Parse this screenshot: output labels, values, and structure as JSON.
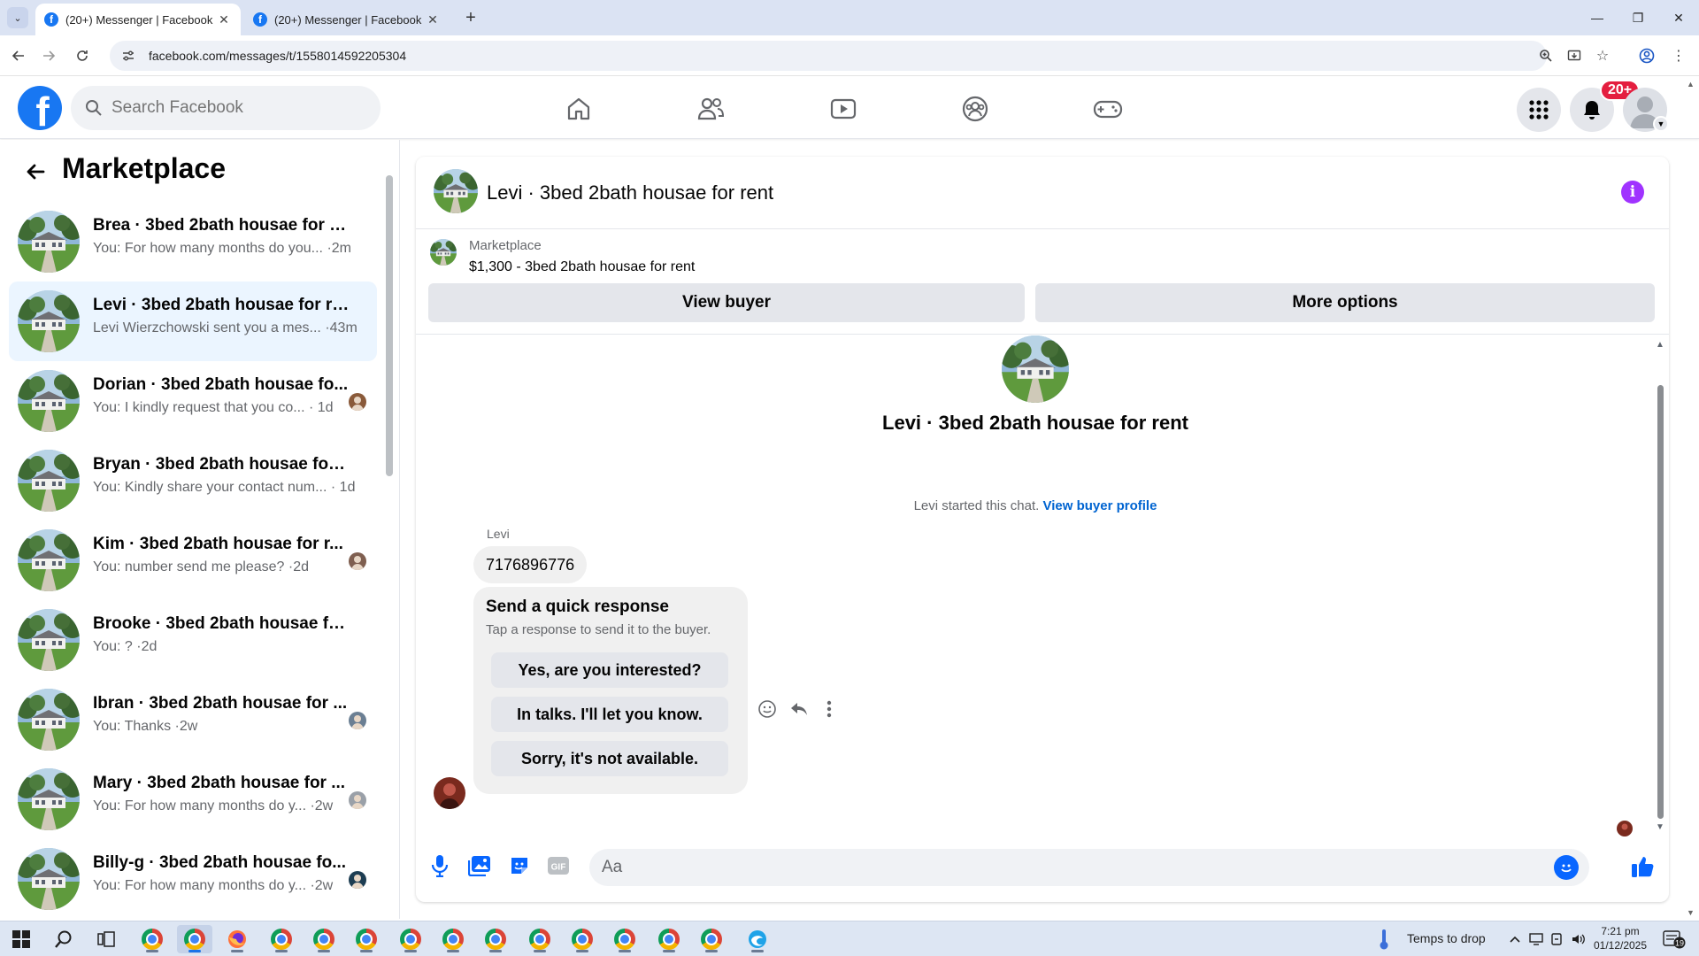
{
  "browser": {
    "tabs": [
      {
        "title": "(20+) Messenger | Facebook",
        "active": true
      },
      {
        "title": "(20+) Messenger | Facebook",
        "active": false
      }
    ],
    "url": "facebook.com/messages/t/1558014592205304"
  },
  "header": {
    "search_placeholder": "Search Facebook",
    "notification_count": "20+",
    "nav_icons": [
      "home-icon",
      "friends-icon",
      "watch-icon",
      "groups-icon",
      "gaming-icon"
    ]
  },
  "sidebar": {
    "title": "Marketplace",
    "conversations": [
      {
        "name": "Brea · 3bed 2bath housae for rent",
        "preview": "You: For how many months do you... ·2m",
        "active": false,
        "mini_avatar": false
      },
      {
        "name": "Levi · 3bed 2bath housae for rent",
        "preview": "Levi Wierzchowski sent you a mes... ·43m",
        "active": true,
        "mini_avatar": false
      },
      {
        "name": "Dorian · 3bed 2bath housae fo...",
        "preview": "You: I kindly request that you co... · 1d",
        "active": false,
        "mini_avatar": true
      },
      {
        "name": "Bryan · 3bed 2bath housae for re...",
        "preview": "You: Kindly share your contact num... · 1d",
        "active": false,
        "mini_avatar": false
      },
      {
        "name": "Kim · 3bed 2bath housae for r...",
        "preview": "You: number send me please? ·2d",
        "active": false,
        "mini_avatar": true
      },
      {
        "name": "Brooke · 3bed 2bath housae for r...",
        "preview": "You: ? ·2d",
        "active": false,
        "mini_avatar": false
      },
      {
        "name": "Ibran · 3bed 2bath housae for ...",
        "preview": "You: Thanks ·2w",
        "active": false,
        "mini_avatar": true
      },
      {
        "name": "Mary · 3bed 2bath housae for ...",
        "preview": "You: For how many months do y... ·2w",
        "active": false,
        "mini_avatar": true
      },
      {
        "name": "Billy-g · 3bed 2bath housae fo...",
        "preview": "You: For how many months do y... ·2w",
        "active": false,
        "mini_avatar": true
      }
    ]
  },
  "chat": {
    "header_title": "Levi · 3bed 2bath housae for rent",
    "listing": {
      "source": "Marketplace",
      "price_title": "$1,300 - 3bed 2bath housae for rent",
      "view_buyer_label": "View buyer",
      "more_options_label": "More options"
    },
    "intro_title": "Levi · 3bed 2bath housae for rent",
    "started_text": "Levi started this chat.",
    "view_profile_link": "View buyer profile",
    "sender_name": "Levi",
    "message_text": "7176896776",
    "quick_response": {
      "title": "Send a quick response",
      "subtitle": "Tap a response to send it to the buyer.",
      "options": [
        "Yes, are you interested?",
        "In talks. I'll let you know.",
        "Sorry, it's not available."
      ]
    },
    "composer_placeholder": "Aa"
  },
  "taskbar": {
    "weather_text": "Temps to drop",
    "time": "7:21 pm",
    "date": "01/12/2025",
    "notification_count": "19"
  },
  "colors": {
    "facebook_blue": "#1877f2",
    "messenger_blue": "#0866ff",
    "link_blue": "#0064d1",
    "active_row": "#ebf5ff",
    "notification_red": "#e41e3f",
    "info_purple": "#a033ff"
  }
}
